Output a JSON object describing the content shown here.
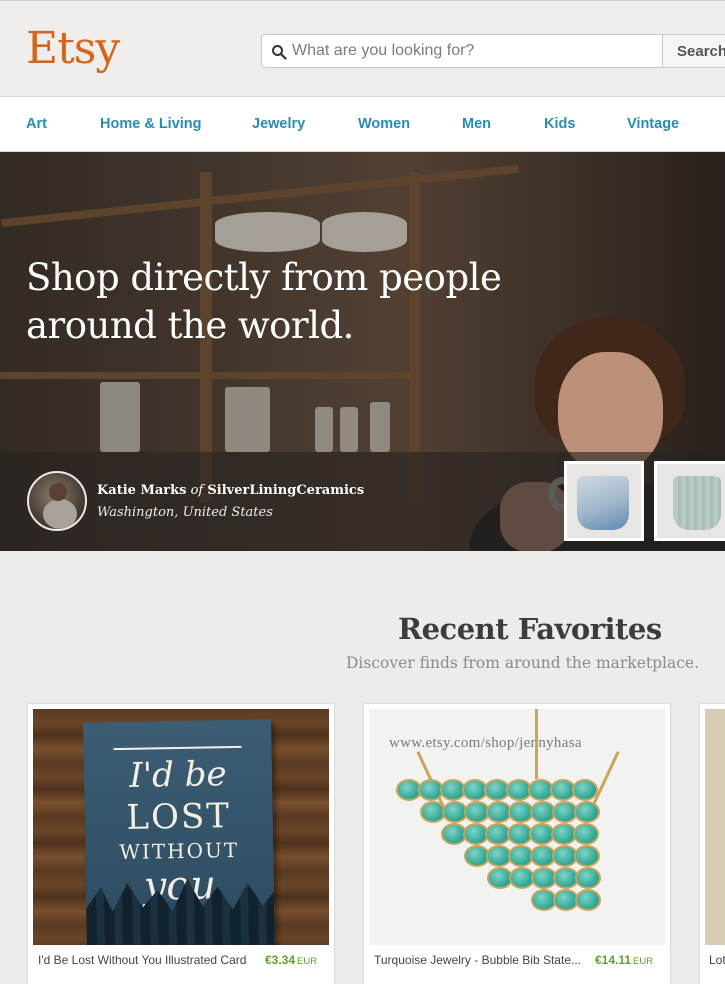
{
  "header": {
    "logo": "Etsy",
    "search": {
      "placeholder": "What are you looking for?",
      "button_label": "Search"
    }
  },
  "nav": {
    "categories": [
      "Art",
      "Home & Living",
      "Jewelry",
      "Women",
      "Men",
      "Kids",
      "Vintage"
    ]
  },
  "hero": {
    "title": "Shop directly from people around the world.",
    "seller": {
      "name": "Katie Marks",
      "connector": "of",
      "shop": "SilverLiningCeramics",
      "location": "Washington, United States"
    },
    "thumbnails": [
      "blue-mug-thumbnail",
      "sage-cup-thumbnail"
    ]
  },
  "favorites": {
    "title": "Recent Favorites",
    "subtitle": "Discover finds from around the marketplace.",
    "items": [
      {
        "title": "I'd Be Lost Without You Illustrated Card",
        "price": "€3.34",
        "currency": "EUR",
        "art_lines": [
          "I'd be",
          "LOST",
          "WITHOUT",
          "you"
        ]
      },
      {
        "title": "Turquoise Jewelry - Bubble Bib State...",
        "price": "€14.11",
        "currency": "EUR",
        "watermark": "www.etsy.com/shop/jennyhasa"
      },
      {
        "title": "Lot"
      }
    ]
  },
  "colors": {
    "brand": "#d5641c",
    "link": "#2a8bb3",
    "price": "#5ba22b"
  }
}
